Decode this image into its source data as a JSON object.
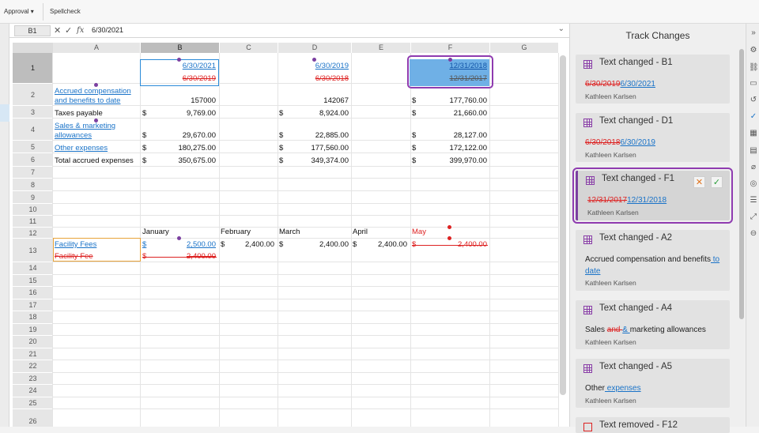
{
  "toolbar": {
    "approval": "Approval ▾",
    "spellcheck": "Spellcheck"
  },
  "formula_bar": {
    "name_box": "B1",
    "cancel": "✕",
    "confirm": "✓",
    "fx": "fx",
    "value": "6/30/2021",
    "expand": "⌄"
  },
  "columns": [
    "A",
    "B",
    "C",
    "D",
    "E",
    "F",
    "G"
  ],
  "rows": [
    "1",
    "2",
    "3",
    "4",
    "5",
    "6",
    "7",
    "8",
    "9",
    "10",
    "11",
    "12",
    "13",
    "14",
    "15",
    "16",
    "17",
    "18",
    "19",
    "20",
    "21",
    "22",
    "23",
    "24",
    "25",
    "26"
  ],
  "sheet": {
    "b1_new": "6/30/2021",
    "b1_old": "6/30/2019",
    "d1_new": "6/30/2019",
    "d1_old": "6/30/2018",
    "f1_new": "12/31/2018",
    "f1_old": "12/31/2017",
    "a2_line1": "Accrued compensation",
    "a2_line2": "and benefits to date",
    "b2": "157000",
    "d2": "142067",
    "f2_cur": "$",
    "f2": "177,760.00",
    "a3": "Taxes payable",
    "b3_cur": "$",
    "b3": "9,769.00",
    "d3_cur": "$",
    "d3": "8,924.00",
    "f3_cur": "$",
    "f3": "21,660.00",
    "a4_line1": "Sales &  marketing",
    "a4_line2": "allowances",
    "b4_cur": "$",
    "b4": "29,670.00",
    "d4_cur": "$",
    "d4": "22,885.00",
    "f4_cur": "$",
    "f4": "28,127.00",
    "a5": "Other expenses",
    "b5_cur": "$",
    "b5": "180,275.00",
    "d5_cur": "$",
    "d5": "177,560.00",
    "f5_cur": "$",
    "f5": "172,122.00",
    "a6": "Total accrued expenses",
    "b6_cur": "$",
    "b6": "350,675.00",
    "d6_cur": "$",
    "d6": "349,374.00",
    "f6_cur": "$",
    "f6": "399,970.00",
    "b12": "January",
    "c12": "February",
    "d12": "March",
    "e12": "April",
    "f12": "May",
    "a13_new": "Facility Fees",
    "a13_old": "Facility Fee",
    "b13_cur": "$",
    "b13_new": "2,500.00",
    "b13_old_cur": "$",
    "b13_old": "2,400.00",
    "c13_cur": "$",
    "c13": "2,400.00",
    "d13_cur": "$",
    "d13": "2,400.00",
    "e13_cur": "$",
    "e13": "2,400.00",
    "f13_cur": "$",
    "f13": "2,400.00"
  },
  "panel": {
    "title": "Track Changes",
    "cards": [
      {
        "title": "Text changed - B1",
        "old": "6/30/2019",
        "new": "6/30/2021",
        "author": "Kathleen Karlsen"
      },
      {
        "title": "Text changed - D1",
        "old": "6/30/2018",
        "new": "6/30/2019",
        "author": "Kathleen Karlsen"
      },
      {
        "title": "Text changed - F1",
        "old": "12/31/2017",
        "new": "12/31/2018",
        "author": "Kathleen Karlsen",
        "reject": "✕",
        "accept": "✓"
      },
      {
        "title": "Text changed - A2",
        "text": "Accrued compensation and benefits",
        "added": " to date",
        "author": "Kathleen Karlsen"
      },
      {
        "title": "Text changed - A4",
        "pre": "Sales ",
        "removed": "and ",
        "added": "& ",
        "post": "marketing allowances",
        "author": "Kathleen Karlsen"
      },
      {
        "title": "Text changed - A5",
        "pre": "Other",
        "added": " expenses",
        "author": "Kathleen Karlsen"
      },
      {
        "title": "Text removed - F12"
      }
    ]
  },
  "colors": {
    "accent": "#8f3bb0",
    "link": "#1a73c8",
    "deleted": "#dd2222",
    "selection": "#2a8ad8"
  }
}
